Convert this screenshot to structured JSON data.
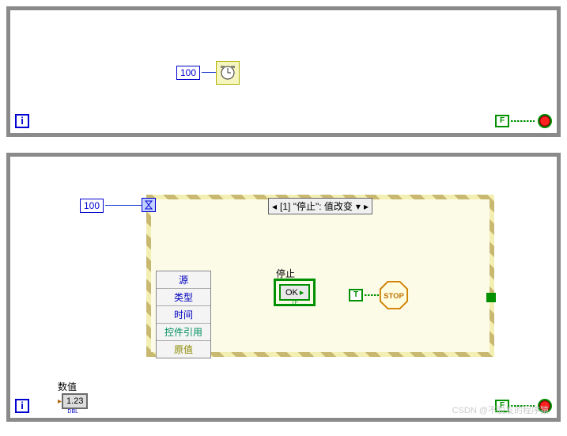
{
  "loop1": {
    "delay_ms": "100",
    "false_const": "F",
    "i_label": "i"
  },
  "loop2": {
    "timeout_ms": "100",
    "i_label": "i",
    "false_const": "F",
    "event_case_label": "[1] \"停止\": 值改变",
    "event_nodes": [
      "源",
      "类型",
      "时间",
      "控件引用",
      "原值"
    ],
    "stop_label": "停止",
    "stop_button_text": "OK",
    "true_const": "T",
    "stop_text": "STOP",
    "numeric": {
      "label": "数值",
      "value": "1.23"
    }
  },
  "watermark": "CSDN @不脱发的程序猿"
}
